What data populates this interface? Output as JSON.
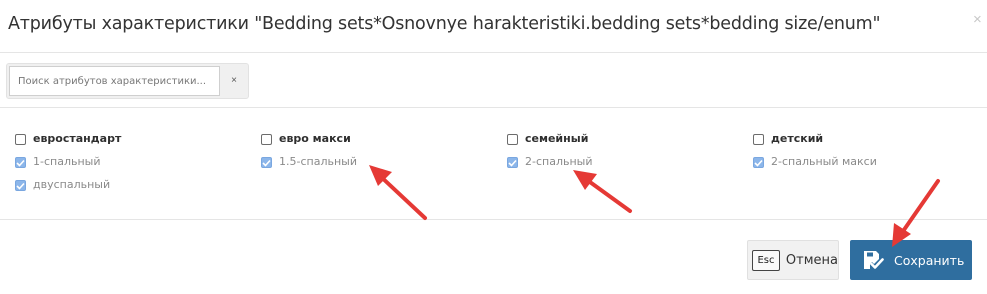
{
  "dialog": {
    "title": "Атрибуты характеристики \"Bedding sets*Osnovnye harakteristiki.bedding sets*bedding size/enum\"",
    "close_symbol": "×"
  },
  "search": {
    "placeholder": "Поиск атрибутов характеристики...",
    "value": "",
    "clear_symbol": "×"
  },
  "attributes": {
    "columns": [
      {
        "items": [
          {
            "label": "евростандарт",
            "checked": false
          },
          {
            "label": "1-спальный",
            "checked": true
          },
          {
            "label": "двуспальный",
            "checked": true
          }
        ]
      },
      {
        "items": [
          {
            "label": "евро макси",
            "checked": false
          },
          {
            "label": "1.5-спальный",
            "checked": true
          }
        ]
      },
      {
        "items": [
          {
            "label": "семейный",
            "checked": false
          },
          {
            "label": "2-спальный",
            "checked": true
          }
        ]
      },
      {
        "items": [
          {
            "label": "детский",
            "checked": false
          },
          {
            "label": "2-спальный макси",
            "checked": true
          }
        ]
      }
    ]
  },
  "footer": {
    "esc_key": "Esc",
    "cancel_label": "Отмена",
    "save_label": "Сохранить"
  },
  "colors": {
    "primary_button": "#2f6e9f",
    "annotation_arrow": "#e53935",
    "checkbox_checked": "#8cb6ea"
  }
}
